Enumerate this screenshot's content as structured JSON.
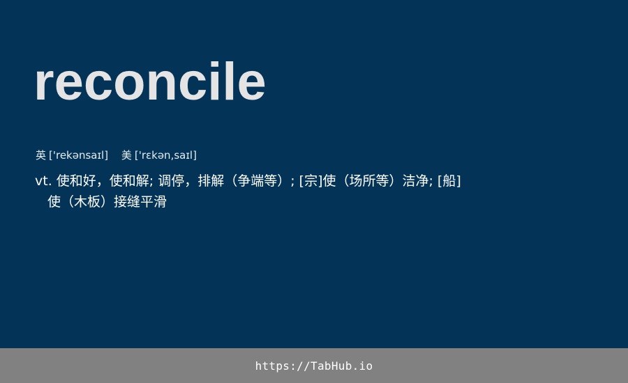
{
  "entry": {
    "word": "reconcile",
    "phonetics": [
      {
        "region": "英",
        "ipa": "['rekənsaɪl]"
      },
      {
        "region": "美",
        "ipa": "['rɛkən,saɪl]"
      }
    ],
    "definition": {
      "line1": "vt. 使和好，使和解; 调停，排解（争端等）; [宗]使（场所等）洁净; [船]",
      "line2": "使（木板）接缝平滑"
    }
  },
  "footer": {
    "link_text": "https://TabHub.io"
  }
}
